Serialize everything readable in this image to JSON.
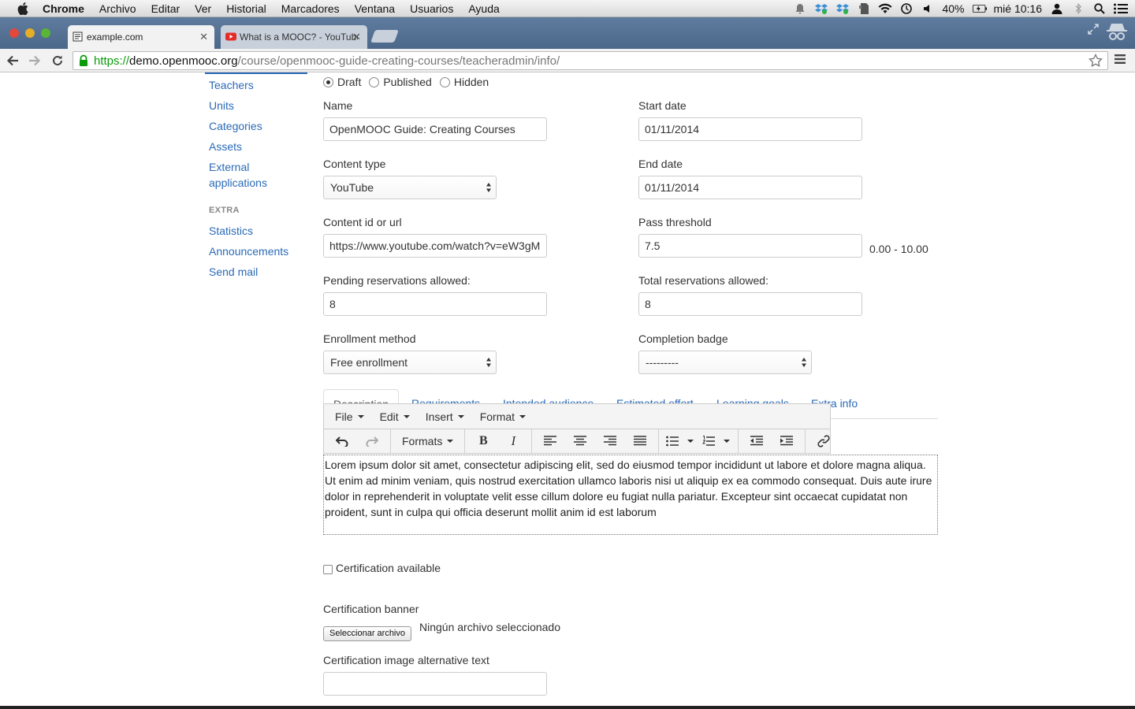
{
  "menubar": {
    "app": "Chrome",
    "items": [
      "Archivo",
      "Editar",
      "Ver",
      "Historial",
      "Marcadores",
      "Ventana",
      "Usuarios",
      "Ayuda"
    ],
    "battery": "40%",
    "clock": "mié 10:16"
  },
  "browser": {
    "tabs": [
      {
        "title": "example.com",
        "active": true
      },
      {
        "title": "What is a MOOC? - YouTube",
        "active": false
      }
    ],
    "url": {
      "scheme": "https://",
      "host": "demo.openmooc.org",
      "path": "/course/openmooc-guide-creating-courses/teacheradmin/info/"
    }
  },
  "sidebar": {
    "items": [
      {
        "label": "Teachers"
      },
      {
        "label": "Units"
      },
      {
        "label": "Categories"
      },
      {
        "label": "Assets"
      },
      {
        "label": "External applications"
      }
    ],
    "extra_heading": "EXTRA",
    "extra_items": [
      {
        "label": "Statistics"
      },
      {
        "label": "Announcements"
      },
      {
        "label": "Send mail"
      }
    ]
  },
  "form": {
    "status": {
      "options": [
        "Draft",
        "Published",
        "Hidden"
      ],
      "selected": "Draft"
    },
    "name": {
      "label": "Name",
      "value": "OpenMOOC Guide: Creating Courses"
    },
    "start_date": {
      "label": "Start date",
      "value": "01/11/2014"
    },
    "content_type": {
      "label": "Content type",
      "value": "YouTube"
    },
    "end_date": {
      "label": "End date",
      "value": "01/11/2014"
    },
    "content_id": {
      "label": "Content id or url",
      "value": "https://www.youtube.com/watch?v=eW3gM"
    },
    "pass_threshold": {
      "label": "Pass threshold",
      "value": "7.5",
      "hint": "0.00 - 10.00"
    },
    "pending_reservations": {
      "label": "Pending reservations allowed:",
      "value": "8"
    },
    "total_reservations": {
      "label": "Total reservations allowed:",
      "value": "8"
    },
    "enrollment_method": {
      "label": "Enrollment method",
      "value": "Free enrollment"
    },
    "completion_badge": {
      "label": "Completion badge",
      "value": "---------"
    },
    "certification_available": {
      "label": "Certification available",
      "checked": false
    },
    "certification_banner": {
      "label": "Certification banner",
      "button": "Seleccionar archivo",
      "status": "Ningún archivo seleccionado"
    },
    "certification_alt": {
      "label": "Certification image alternative text",
      "value": ""
    }
  },
  "content_tabs": {
    "items": [
      "Description",
      "Requirements",
      "Intended audience",
      "Estimated effort",
      "Learning goals",
      "Extra info"
    ],
    "active": "Description"
  },
  "editor": {
    "menu": [
      "File",
      "Edit",
      "Insert",
      "Format"
    ],
    "formats_label": "Formats",
    "body": "Lorem ipsum dolor sit amet, consectetur adipiscing elit, sed do eiusmod tempor incididunt ut labore et dolore magna aliqua. Ut enim ad minim veniam, quis nostrud exercitation ullamco laboris nisi ut aliquip ex ea commodo consequat. Duis aute irure dolor in reprehenderit in voluptate velit esse cillum dolore eu fugiat nulla pariatur. Excepteur sint occaecat cupidatat non proident, sunt in culpa qui officia deserunt mollit anim id est laborum"
  }
}
